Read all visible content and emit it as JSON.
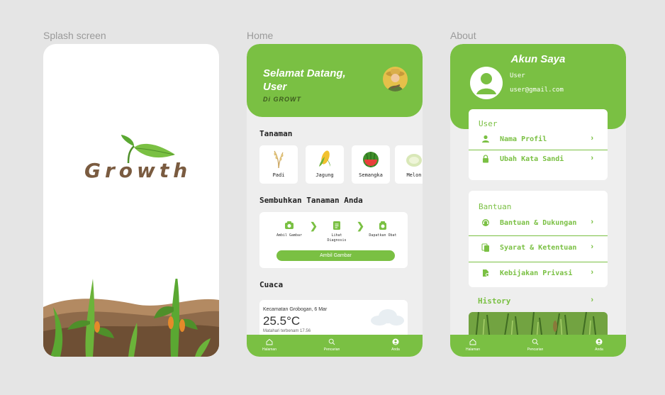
{
  "frames": {
    "splash_label": "Splash screen",
    "home_label": "Home",
    "about_label": "About"
  },
  "splash": {
    "logo_text": "Growth"
  },
  "home": {
    "welcome": "Selamat Datang, User",
    "subtitle": "Di GROWT",
    "plants_title": "Tanaman",
    "plants": [
      {
        "label": "Padi",
        "icon": "rice-icon"
      },
      {
        "label": "Jagung",
        "icon": "corn-icon"
      },
      {
        "label": "Semangka",
        "icon": "watermelon-icon"
      },
      {
        "label": "Melon",
        "icon": "melon-icon"
      }
    ],
    "heal_title": "Sembuhkan Tanaman Anda",
    "steps": [
      {
        "label": "Ambil Gambar",
        "icon": "camera-icon"
      },
      {
        "label": "Lihat Diagnosis",
        "icon": "document-icon"
      },
      {
        "label": "Dapatkan Obat",
        "icon": "medicine-icon"
      }
    ],
    "take_photo_button": "Ambil Gambar",
    "weather_title": "Cuaca",
    "weather": {
      "location": "Kecamatan Grobogan, 6 Mar",
      "temperature": "25.5°C",
      "sunset": "Matahari terbenam 17.56"
    }
  },
  "about": {
    "title": "Akun Saya",
    "user_name": "User",
    "user_email": "user@gmail.com",
    "user_section": "User",
    "user_items": [
      {
        "label": "Nama Profil",
        "icon": "person-icon"
      },
      {
        "label": "Ubah Kata Sandi",
        "icon": "lock-icon"
      }
    ],
    "help_section": "Bantuan",
    "help_items": [
      {
        "label": "Bantuan & Dukungan",
        "icon": "support-icon"
      },
      {
        "label": "Syarat & Ketentuan",
        "icon": "copy-icon"
      },
      {
        "label": "Kebijakan Privasi",
        "icon": "privacy-file-icon"
      }
    ],
    "history_label": "History",
    "chevron": "›"
  },
  "tabbar": [
    {
      "label": "Halaman",
      "icon": "home-icon"
    },
    {
      "label": "Pencarian",
      "icon": "search-icon"
    },
    {
      "label": "Anda",
      "icon": "account-icon"
    }
  ],
  "colors": {
    "accent": "#7ac043",
    "background": "#e5e5e5",
    "soil": "#7a5b40"
  }
}
